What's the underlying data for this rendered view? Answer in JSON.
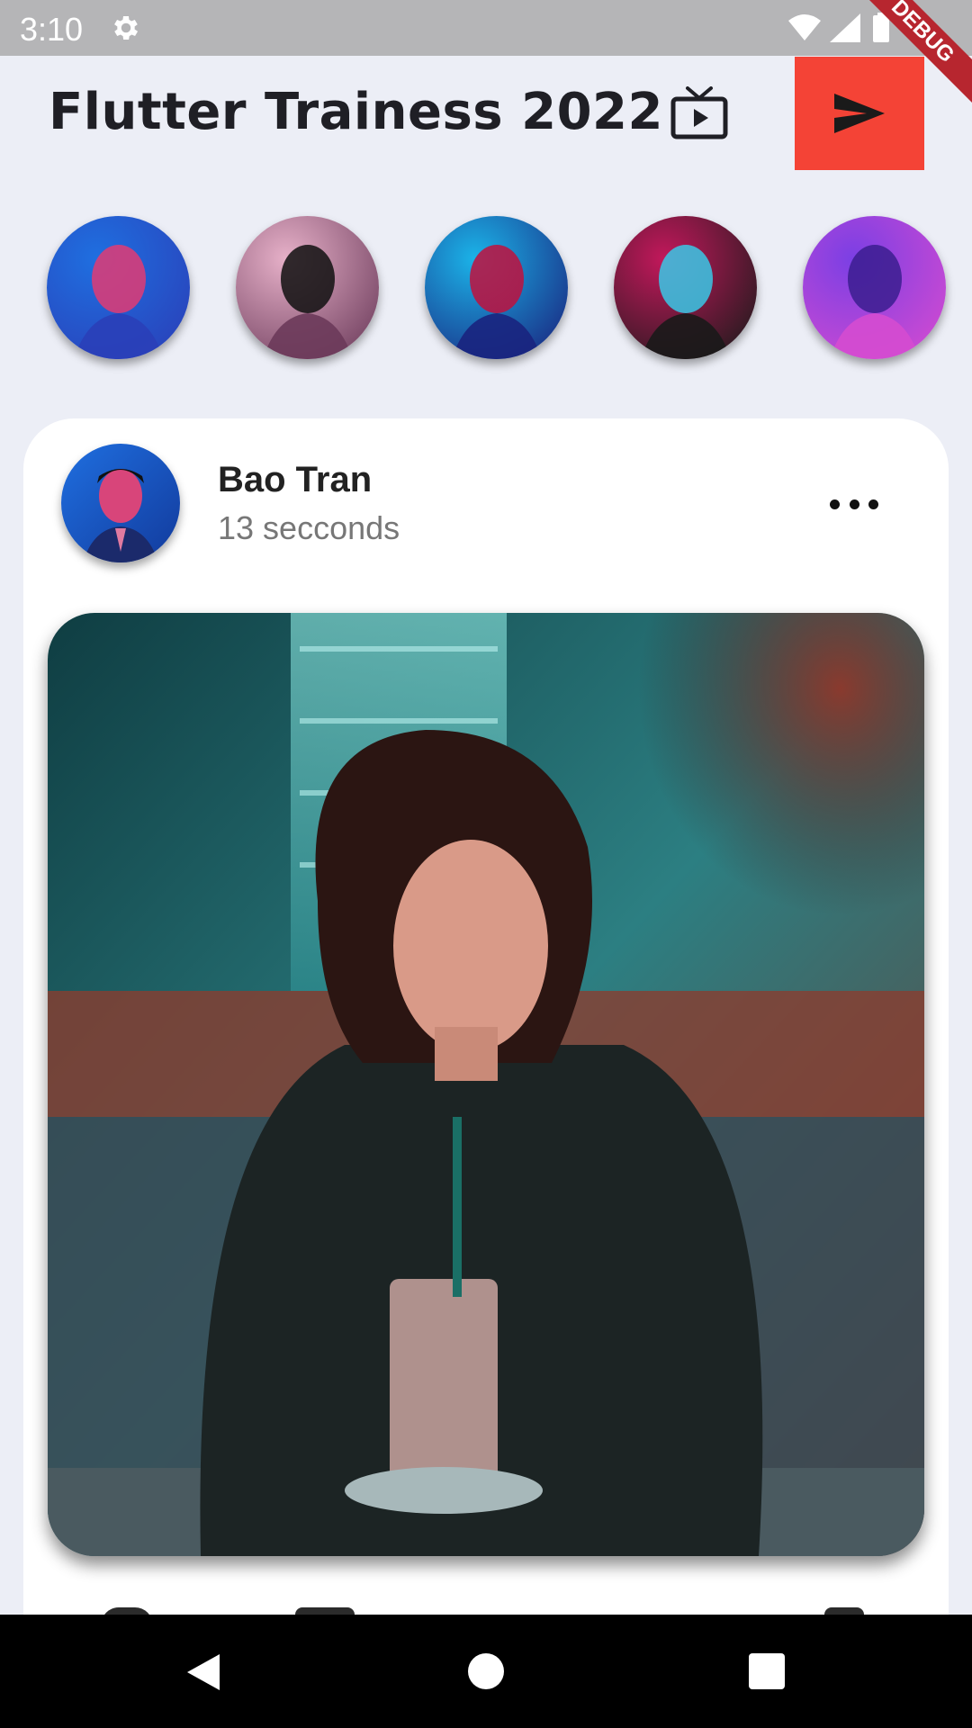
{
  "status_bar": {
    "time": "3:10",
    "debug_label": "DEBUG"
  },
  "header": {
    "title": "Flutter Trainess 2022",
    "tv_icon": "tv-icon",
    "send_icon": "send-icon",
    "send_color": "#f44336"
  },
  "stories": [
    {
      "name": "story-1",
      "colors": [
        "#1f6fe0",
        "#2a3fb8",
        "#e23b73"
      ]
    },
    {
      "name": "story-2",
      "colors": [
        "#e6b0c8",
        "#6b3a5a",
        "#111111"
      ]
    },
    {
      "name": "story-3",
      "colors": [
        "#1bb3e8",
        "#1a237e",
        "#c0113d"
      ]
    },
    {
      "name": "story-4",
      "colors": [
        "#c2185b",
        "#1a1a1a",
        "#3ac8e6"
      ]
    },
    {
      "name": "story-5",
      "colors": [
        "#7b3fe4",
        "#d54bd0",
        "#3b1d8f"
      ]
    }
  ],
  "post": {
    "author": "Bao Tran",
    "time": "13 secconds",
    "more_icon": "more-icon"
  }
}
